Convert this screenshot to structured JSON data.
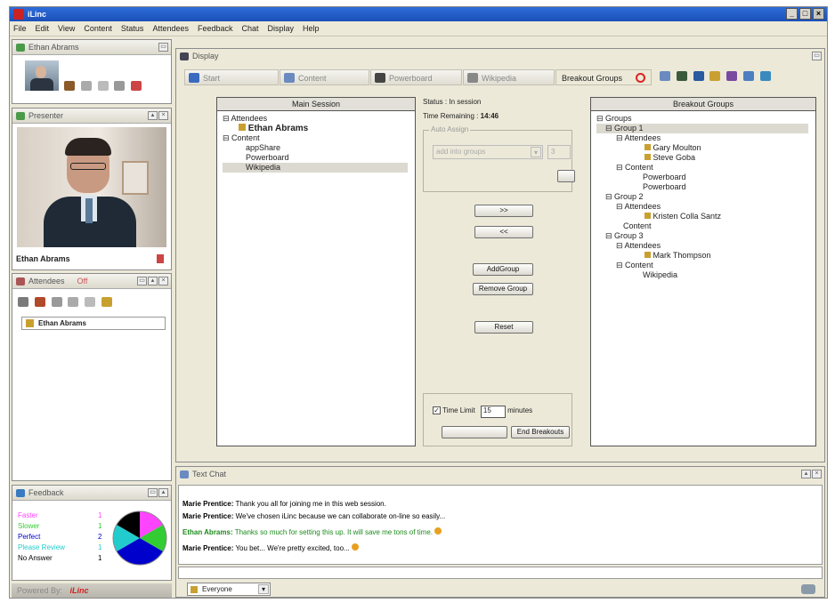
{
  "window": {
    "title": "iLinc"
  },
  "menu": [
    "File",
    "Edit",
    "View",
    "Content",
    "Status",
    "Attendees",
    "Feedback",
    "Chat",
    "Display",
    "Help"
  ],
  "user_panel": {
    "title": "Ethan Abrams"
  },
  "presenter": {
    "title": "Presenter",
    "name": "Ethan Abrams"
  },
  "attendees_panel": {
    "title": "Attendees",
    "status": "Off",
    "list": [
      "Ethan Abrams"
    ]
  },
  "feedback": {
    "title": "Feedback",
    "rows": [
      {
        "label": "Faster",
        "count": "1",
        "color": "#ff44ff"
      },
      {
        "label": "Slower",
        "count": "1",
        "color": "#33cc33"
      },
      {
        "label": "Perfect",
        "count": "2",
        "color": "#0000cc"
      },
      {
        "label": "Please Review",
        "count": "1",
        "color": "#22cccc"
      },
      {
        "label": "No Answer",
        "count": "1",
        "color": "#000000"
      }
    ],
    "powered_by": "Powered By:",
    "brand": "iLinc"
  },
  "display": {
    "title": "Display",
    "tabs": [
      "Start",
      "Content",
      "Powerboard",
      "Wikipedia",
      "Breakout Groups"
    ]
  },
  "main_session": {
    "header": "Main Session",
    "tree": [
      "Attendees",
      "Ethan Abrams",
      "Content",
      "appShare",
      "Powerboard",
      "Wikipedia"
    ]
  },
  "controls": {
    "status_label": "Status :",
    "status_value": "In session",
    "time_label": "Time Remaining :",
    "time_value": "14:46",
    "auto_assign": "Auto Assign",
    "assign_select": "add into groups",
    "assign_count": "3",
    "move_right": ">>",
    "move_left": "<<",
    "add_group": "AddGroup",
    "remove_group": "Remove Group",
    "reset": "Reset",
    "time_limit_label": "Time Limit",
    "time_limit_value": "15",
    "minutes": "minutes",
    "end_breakouts": "End Breakouts"
  },
  "breakout": {
    "header": "Breakout Groups",
    "root": "Groups",
    "groups": [
      {
        "name": "Group 1",
        "attendees": [
          "Gary Moulton",
          "Steve Goba"
        ],
        "content": [
          "Powerboard",
          "Powerboard"
        ]
      },
      {
        "name": "Group 2",
        "attendees": [
          "Kristen Colla Santz"
        ],
        "content": []
      },
      {
        "name": "Group 3",
        "attendees": [
          "Mark Thompson"
        ],
        "content": [
          "Wikipedia"
        ]
      }
    ],
    "attendees_label": "Attendees",
    "content_label": "Content"
  },
  "chat": {
    "title": "Text Chat",
    "messages": [
      {
        "sender": "Marie Prentice:",
        "text": "Thank you all for joining me in this web session.",
        "color": "#000"
      },
      {
        "sender": "Marie Prentice:",
        "text": "We've chosen iLinc because we can collaborate on-line so easily...",
        "color": "#000"
      },
      {
        "sender": "Ethan Abrams:",
        "text": "Thanks so much for setting this up. It will save me tons of time.",
        "color": "#1e8a1e"
      },
      {
        "sender": "Marie Prentice:",
        "text": "You bet... We're pretty excited, too...",
        "color": "#000"
      }
    ],
    "recipient": "Everyone"
  }
}
